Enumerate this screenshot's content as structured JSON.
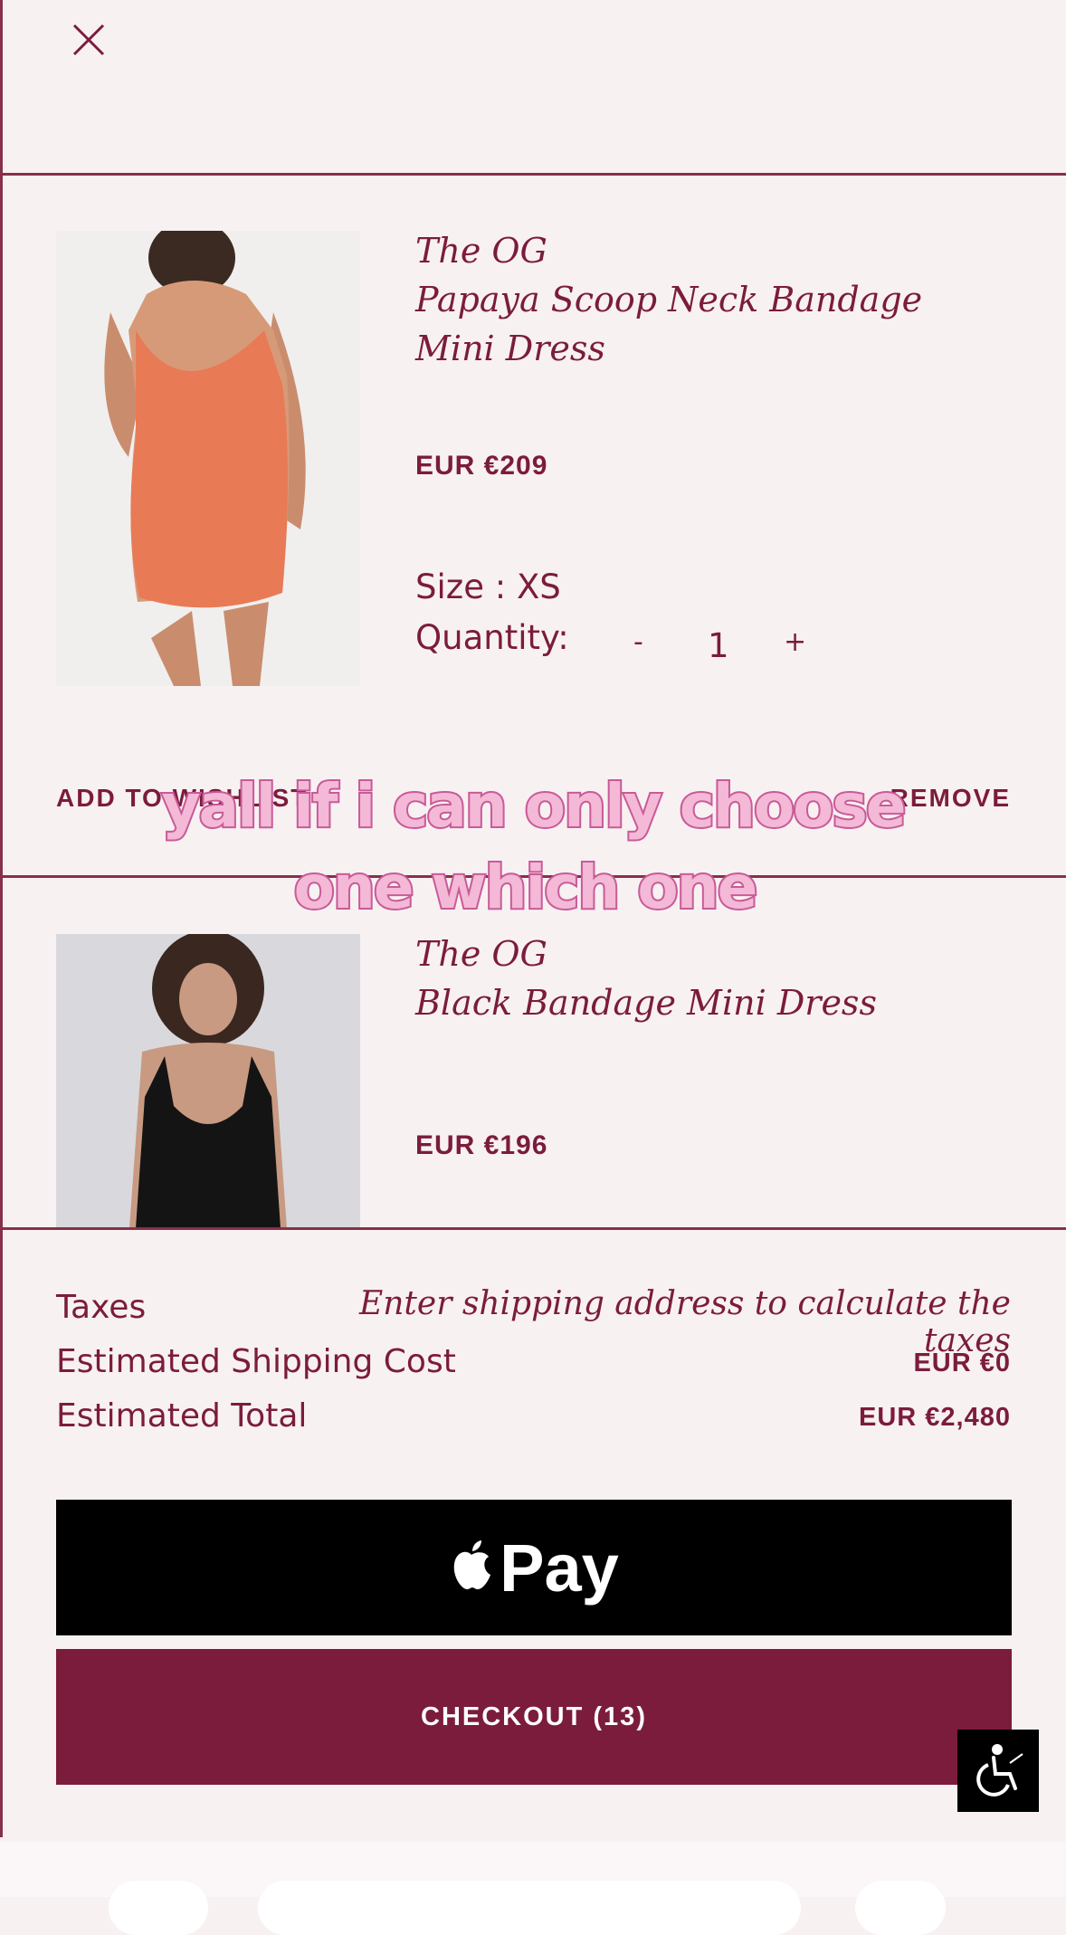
{
  "close": {
    "icon": "close-icon"
  },
  "items": [
    {
      "brand": "The OG",
      "name": "Papaya Scoop Neck Bandage Mini Dress",
      "price": "EUR €209",
      "size": "Size : XS",
      "quantity_label": "Quantity:",
      "quantity": "1",
      "decrement": "-",
      "increment": "+",
      "add_to_wishlist": "ADD TO WISHLIST",
      "remove": "REMOVE",
      "dress_color": "#e87a56"
    },
    {
      "brand": "The OG",
      "name": "Black Bandage Mini Dress",
      "price": "EUR €196",
      "dress_color": "#141414"
    }
  ],
  "summary": {
    "taxes_label": "Taxes",
    "taxes_note": "Enter shipping address to calculate the taxes",
    "shipping_label": "Estimated Shipping Cost",
    "shipping_value": "EUR €0",
    "total_label": "Estimated Total",
    "total_value": "EUR €2,480"
  },
  "buttons": {
    "apple_pay_label": "Pay",
    "checkout_label": "CHECKOUT (13)"
  },
  "overlay_caption": {
    "line1": "yall if i can only choose",
    "line2": "one which one"
  },
  "accessibility": {
    "icon": "wheelchair-icon"
  },
  "colors": {
    "accent": "#7b1c3c",
    "background": "#f8f1f2",
    "apple_pay": "#000000"
  }
}
